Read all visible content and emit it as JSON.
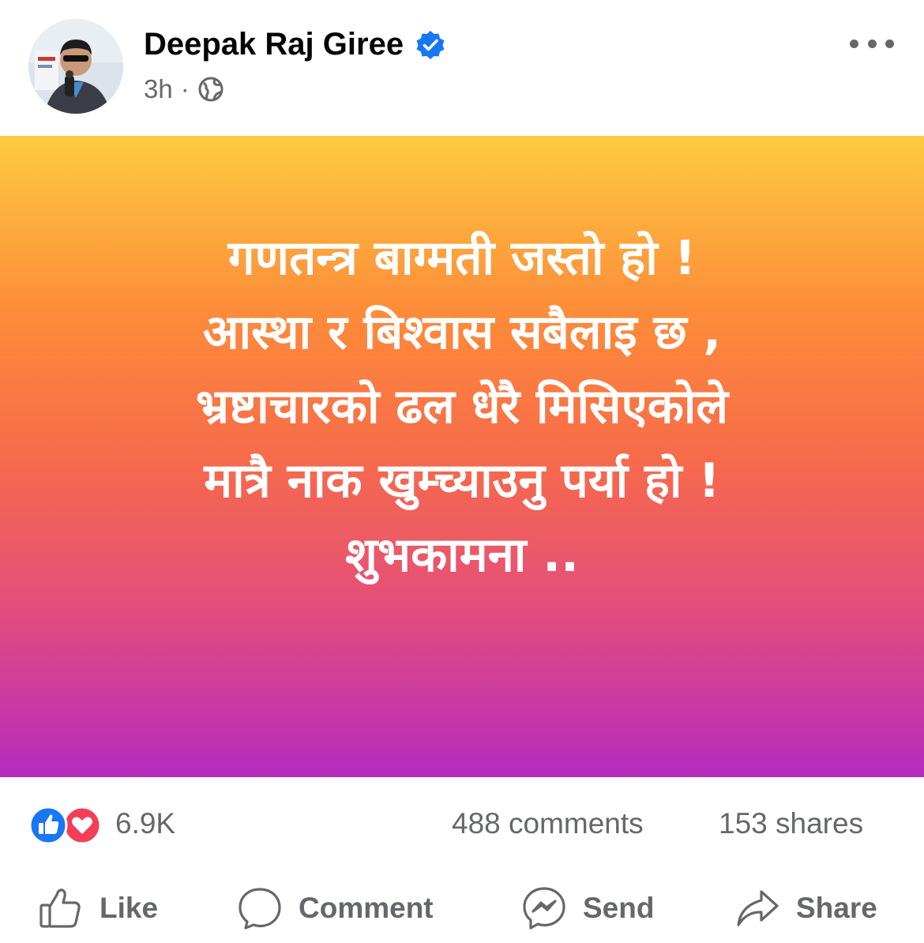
{
  "post": {
    "author": "Deepak Raj Giree",
    "verified": true,
    "time": "3h",
    "separator": "·",
    "audience_icon": "globe-icon",
    "more_icon": "more-horizontal-icon",
    "text_lines": [
      "गणतन्त्र बाग्मती जस्तो हो !",
      "आस्था र बिश्वास सबैलाइ छ ,",
      "भ्रष्टाचारको ढल धेरै मिसिएकोले",
      "मात्रै नाक खुम्च्याउनु पर्या हो !",
      "शुभकामना .."
    ],
    "background_gradient": [
      "#fdcb40",
      "#fd8b3a",
      "#f76b4a",
      "#e64f78",
      "#b52bbf"
    ]
  },
  "stats": {
    "reaction_icons": [
      "like-reaction-icon",
      "love-reaction-icon"
    ],
    "reactions": "6.9K",
    "comments": "488 comments",
    "shares": "153 shares"
  },
  "actions": {
    "like": "Like",
    "comment": "Comment",
    "send": "Send",
    "share": "Share"
  },
  "colors": {
    "verified": "#1877f2",
    "like": "#1877f2",
    "love": "#f33e58",
    "muted_text": "#65676b"
  }
}
